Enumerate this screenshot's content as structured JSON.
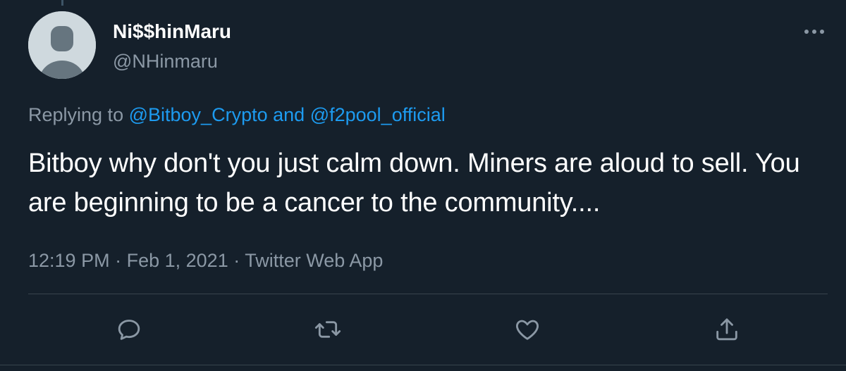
{
  "tweet": {
    "author": {
      "display_name": "Ni$$hinMaru",
      "handle": "@NHinmaru",
      "avatar": "default-avatar-icon"
    },
    "reply": {
      "prefix": "Replying to",
      "mention_1": "@Bitboy_Crypto",
      "conjunction": "and",
      "mention_2": "@f2pool_official"
    },
    "text": "Bitboy why don't you just calm down. Miners are aloud to sell. You are beginning to be a cancer to the community....",
    "time": "12:19 PM",
    "separator": "·",
    "date": "Feb 1, 2021",
    "source": "Twitter Web App"
  },
  "actions": {
    "icons": [
      "reply-icon",
      "retweet-icon",
      "like-icon",
      "share-icon"
    ]
  },
  "colors": {
    "background": "#15202b",
    "text_primary": "#ffffff",
    "text_secondary": "#8b98a5",
    "link": "#1d9bf0",
    "divider": "#38444d"
  }
}
